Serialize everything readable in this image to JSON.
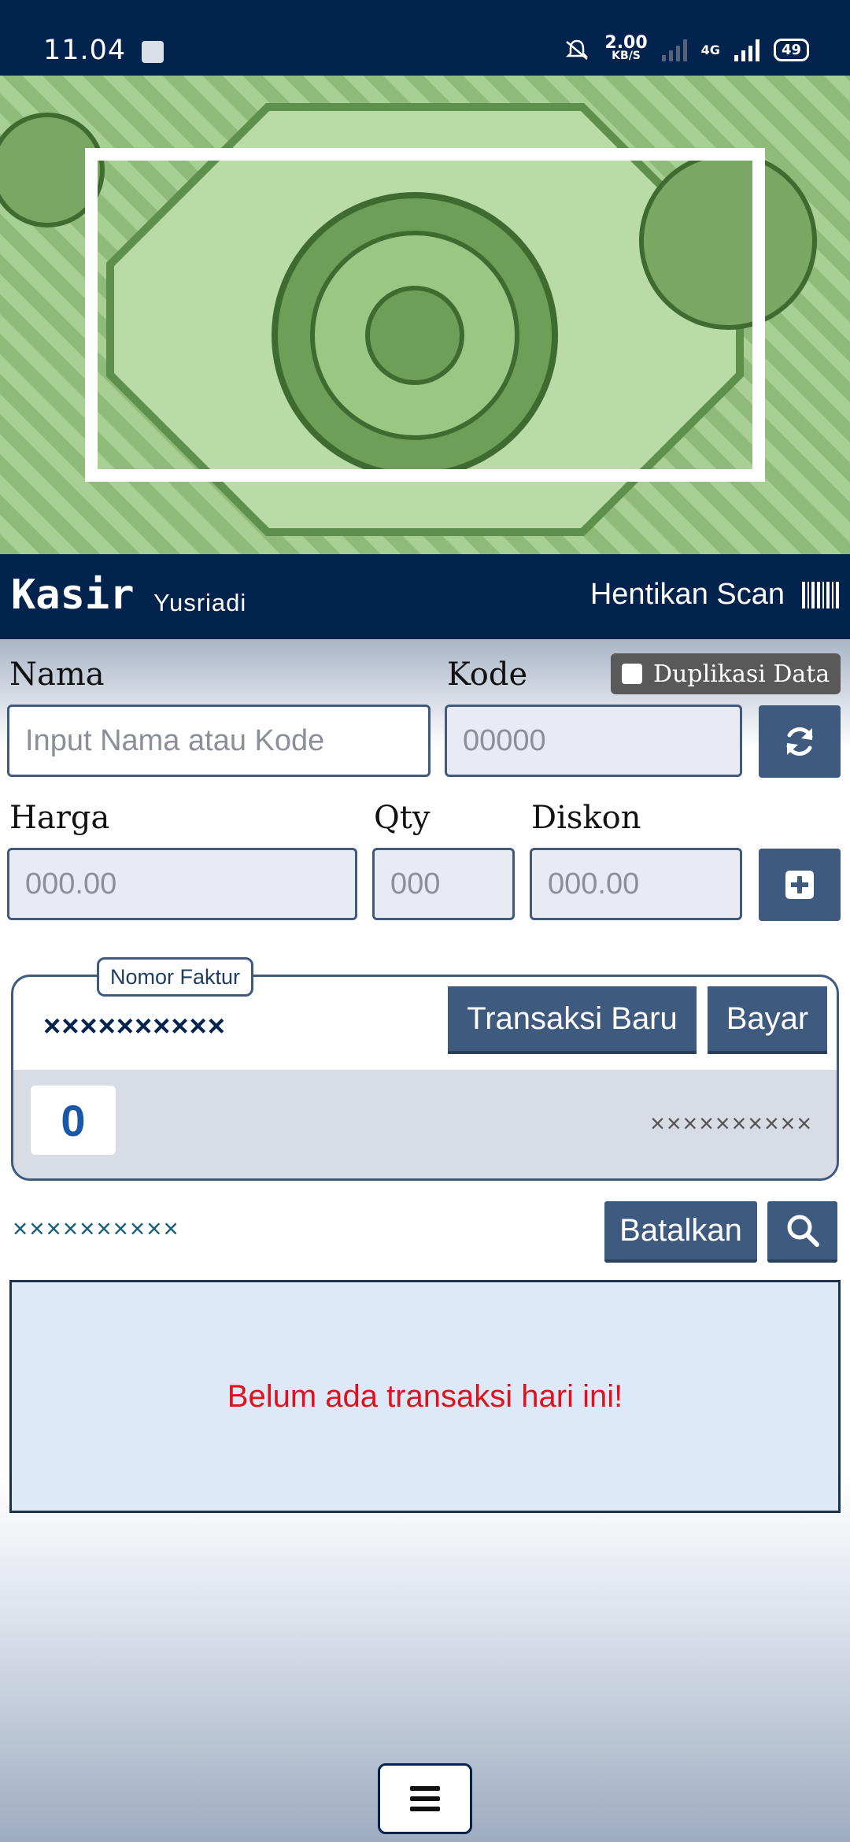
{
  "status_bar": {
    "time": "11.04",
    "net_speed": "2.00",
    "net_unit": "KB/S",
    "network_type": "4G",
    "battery": "49"
  },
  "header": {
    "title": "Kasir",
    "user": "Yusriadi",
    "scan_label": "Hentikan Scan"
  },
  "form": {
    "duplicate_label": "Duplikasi Data",
    "name_label": "Nama",
    "name_placeholder": "Input Nama atau Kode",
    "code_label": "Kode",
    "code_placeholder": "00000",
    "price_label": "Harga",
    "price_placeholder": "000.00",
    "qty_label": "Qty",
    "qty_placeholder": "000",
    "discount_label": "Diskon",
    "discount_placeholder": "000.00"
  },
  "invoice": {
    "legend": "Nomor Faktur",
    "number": "××××××××××",
    "new_transaction": "Transaksi Baru",
    "pay": "Bayar",
    "count": "0",
    "total": "××××××××××"
  },
  "transactions": {
    "label": "××××××××××",
    "cancel": "Batalkan",
    "empty_message": "Belum ada transaksi hari ini!"
  },
  "colors": {
    "navy": "#03234f",
    "button": "#3e5a7e",
    "empty_text": "#e0111b"
  }
}
